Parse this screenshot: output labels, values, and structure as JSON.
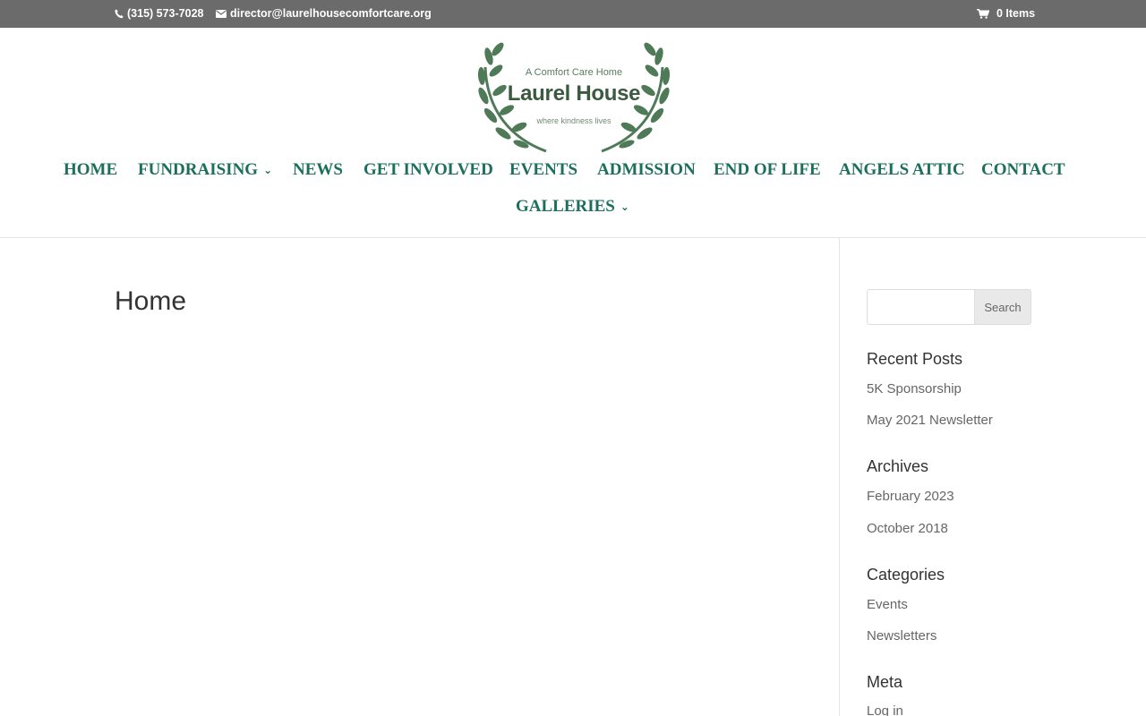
{
  "topbar": {
    "phone": "(315) 573-7028",
    "email": "director@laurelhousecomfortcare.org",
    "cart": "0 Items"
  },
  "logo": {
    "line1": "A Comfort Care Home",
    "line2": "Laurel House",
    "line3": "where kindness lives",
    "color": "#3f6b48"
  },
  "nav": {
    "home": "HOME",
    "fundraising": "FUNDRAISING",
    "news": "NEWS",
    "get_involved": "GET INVOLVED",
    "events": "EVENTS",
    "admission": "ADMISSION",
    "end_of_life": "END OF LIFE",
    "angels_attic": "ANGELS ATTIC",
    "contact": "CONTACT",
    "galleries": "GALLERIES",
    "color": "#1b6f5c"
  },
  "main": {
    "title": "Home"
  },
  "sidebar": {
    "search_button": "Search",
    "recent_posts": {
      "title": "Recent Posts",
      "items": [
        "5K Sponsorship",
        "May 2021 Newsletter"
      ]
    },
    "archives": {
      "title": "Archives",
      "items": [
        "February 2023",
        "October 2018"
      ]
    },
    "categories": {
      "title": "Categories",
      "items": [
        "Events",
        "Newsletters"
      ]
    },
    "meta": {
      "title": "Meta",
      "items": [
        "Log in"
      ]
    }
  }
}
